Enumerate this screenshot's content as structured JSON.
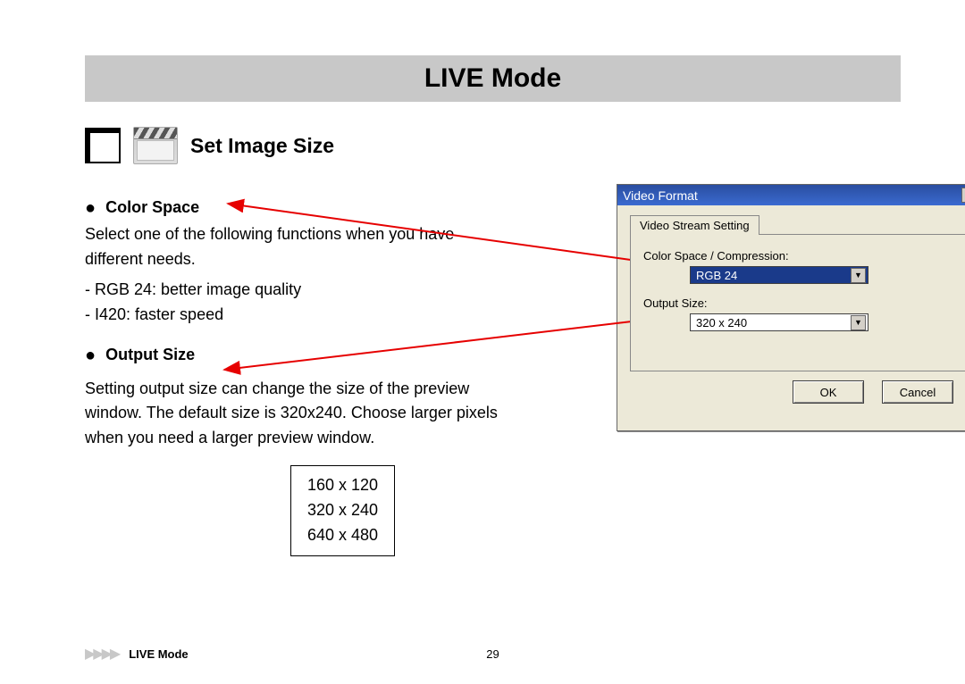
{
  "header": {
    "title": "LIVE Mode"
  },
  "section": {
    "title": "Set Image Size"
  },
  "color_space": {
    "heading": "Color Space",
    "desc": "Select one of the following functions when you have different needs.",
    "opt1": "RGB 24: better image quality",
    "opt2": "I420: faster speed"
  },
  "output_size": {
    "heading": "Output Size",
    "desc": "Setting output size can change the size of the preview window. The default size is 320x240. Choose larger pixels when you need a larger preview window."
  },
  "sizes": {
    "s0": "160 x 120",
    "s1": "320 x 240",
    "s2": "640 x 480"
  },
  "dialog": {
    "title": "Video Format",
    "tab": "Video Stream Setting",
    "label_cs": "Color Space / Compression:",
    "value_cs": "RGB 24",
    "label_os": "Output Size:",
    "value_os": "320 x 240",
    "ok": "OK",
    "cancel": "Cancel"
  },
  "footer": {
    "section": "LIVE Mode",
    "page": "29"
  }
}
